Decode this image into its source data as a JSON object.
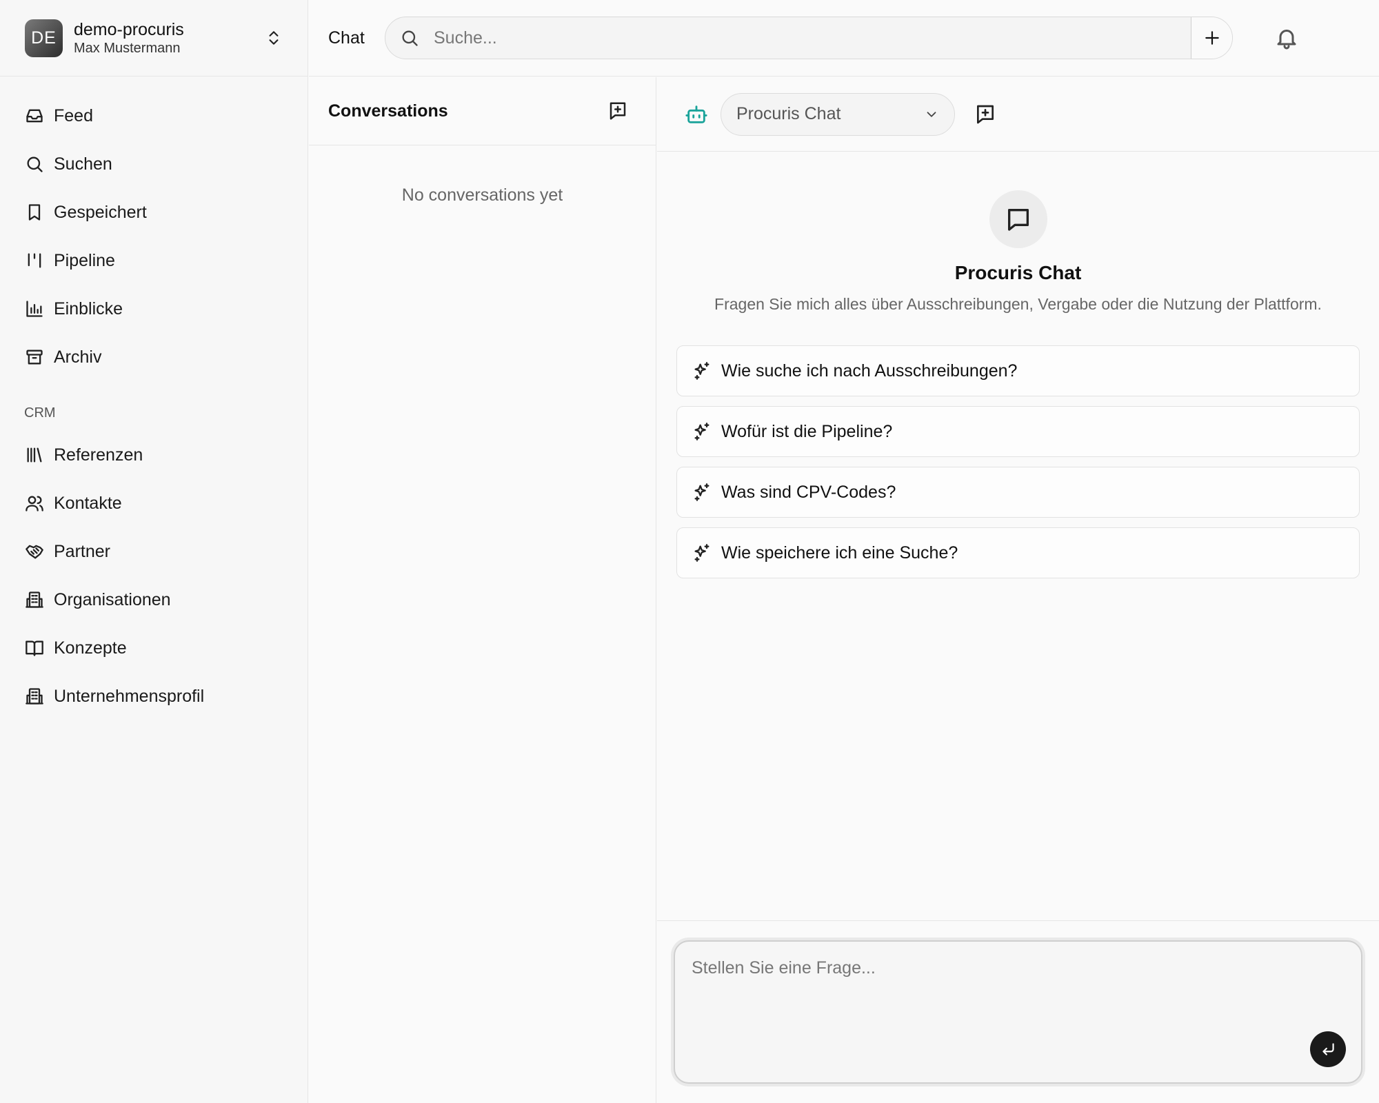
{
  "workspace": {
    "initials": "DE",
    "name": "demo-procuris",
    "user": "Max Mustermann"
  },
  "sidebar": {
    "items": [
      {
        "label": "Feed",
        "icon": "inbox-icon"
      },
      {
        "label": "Suchen",
        "icon": "search-icon"
      },
      {
        "label": "Gespeichert",
        "icon": "bookmark-icon"
      },
      {
        "label": "Pipeline",
        "icon": "pipeline-icon"
      },
      {
        "label": "Einblicke",
        "icon": "bar-chart-icon"
      },
      {
        "label": "Archiv",
        "icon": "archive-icon"
      }
    ],
    "crm_label": "CRM",
    "crm_items": [
      {
        "label": "Referenzen",
        "icon": "library-icon"
      },
      {
        "label": "Kontakte",
        "icon": "users-icon"
      },
      {
        "label": "Partner",
        "icon": "handshake-icon"
      },
      {
        "label": "Organisationen",
        "icon": "building-icon"
      },
      {
        "label": "Konzepte",
        "icon": "book-open-icon"
      },
      {
        "label": "Unternehmensprofil",
        "icon": "building-icon"
      }
    ]
  },
  "topbar": {
    "title": "Chat",
    "search_placeholder": "Suche..."
  },
  "conversations": {
    "title": "Conversations",
    "empty_text": "No conversations yet"
  },
  "chat": {
    "model": "Procuris Chat",
    "welcome_title": "Procuris Chat",
    "welcome_subtitle": "Fragen Sie mich alles über Ausschreibungen, Vergabe oder die Nutzung der Plattform.",
    "suggestions": [
      "Wie suche ich nach Ausschreibungen?",
      "Wofür ist die Pipeline?",
      "Was sind CPV-Codes?",
      "Wie speichere ich eine Suche?"
    ],
    "input_placeholder": "Stellen Sie eine Frage..."
  },
  "colors": {
    "accent": "#1aa39a",
    "send_button": "#1a1a1a"
  }
}
